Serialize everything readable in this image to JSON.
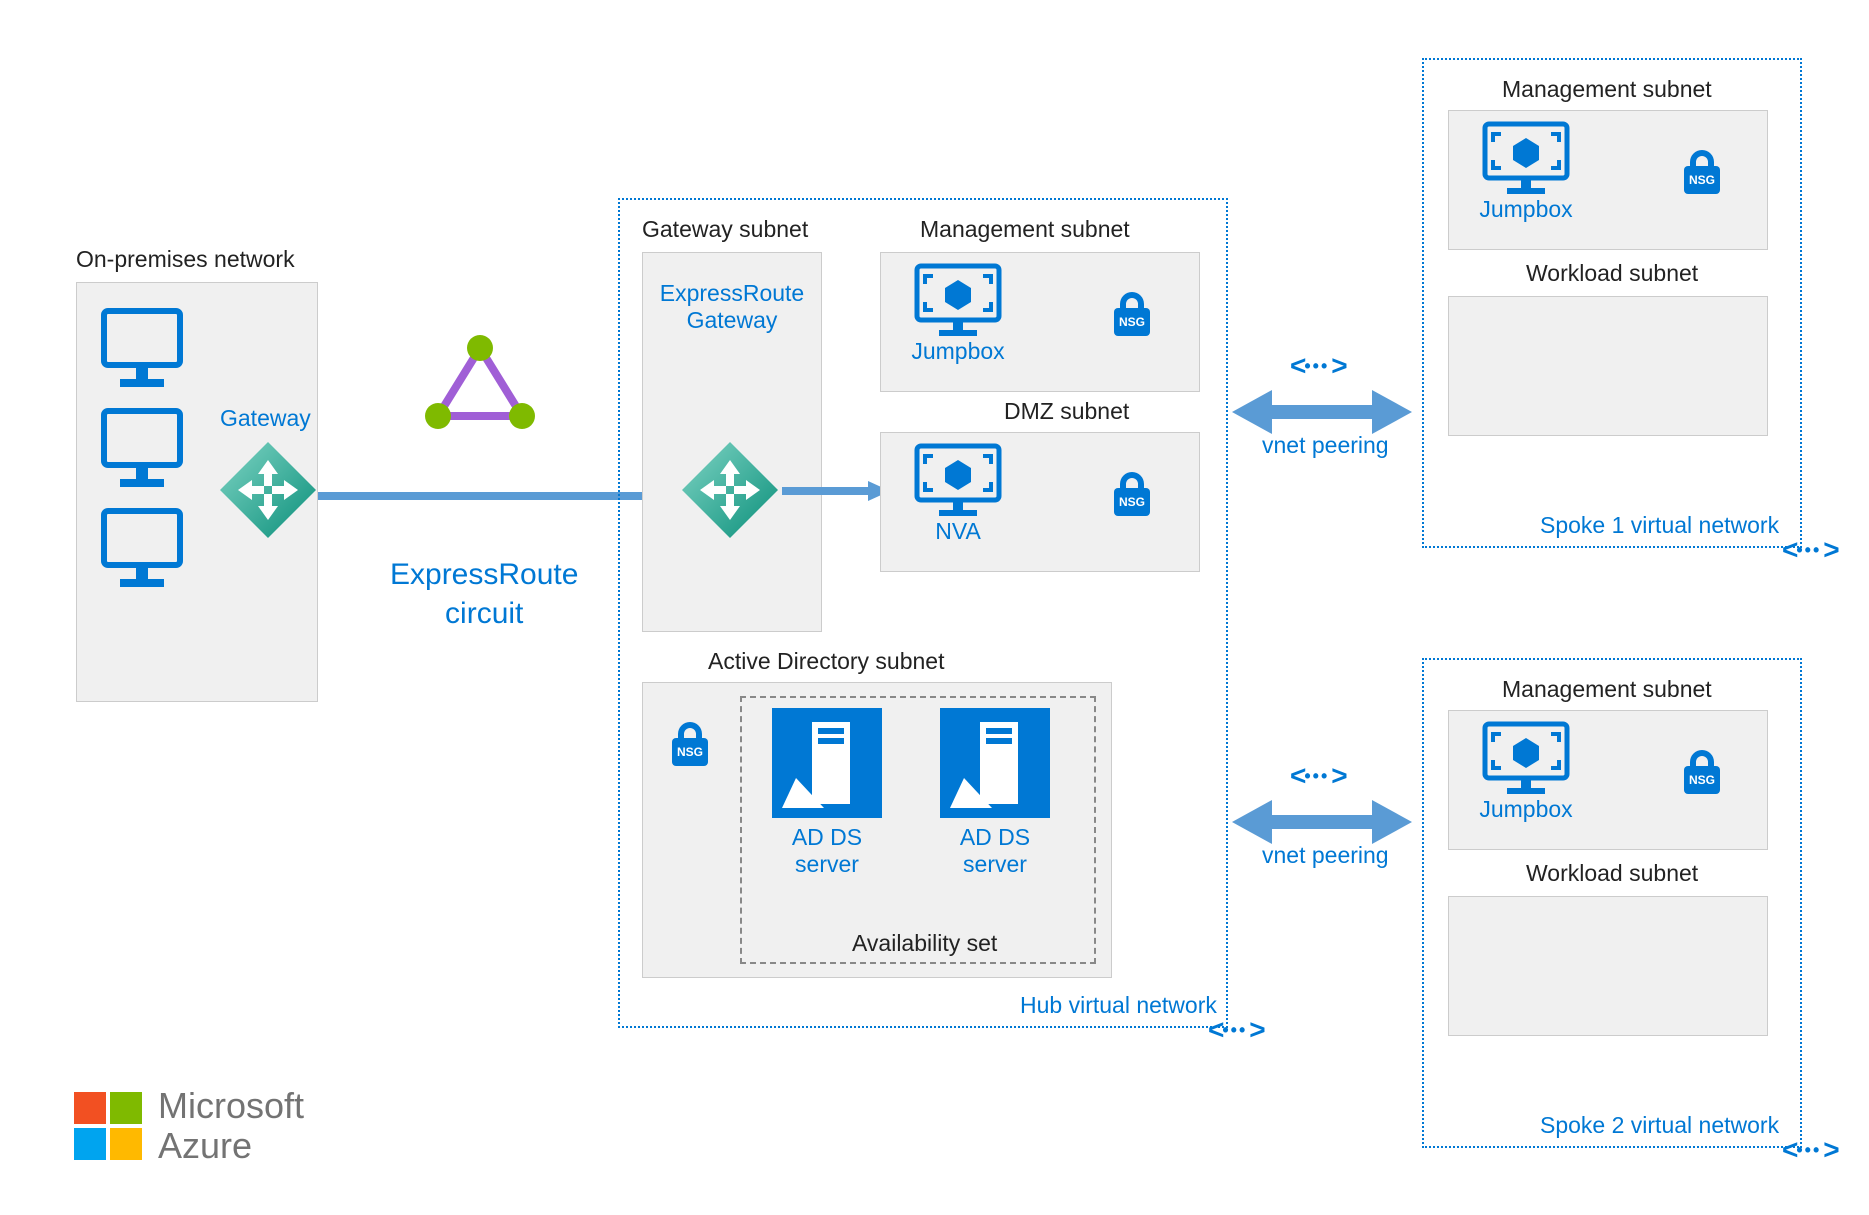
{
  "onprem": {
    "title": "On-premises network",
    "gateway": "Gateway"
  },
  "circuit": {
    "label": "ExpressRoute\ncircuit"
  },
  "hub": {
    "title": "Hub virtual network",
    "gateway_subnet": {
      "title": "Gateway subnet",
      "gateway": "ExpressRoute\nGateway"
    },
    "mgmt": {
      "title": "Management subnet",
      "jumpbox": "Jumpbox",
      "nsg": "NSG"
    },
    "dmz": {
      "title": "DMZ subnet",
      "nva": "NVA",
      "nsg": "NSG"
    },
    "ad": {
      "title": "Active Directory subnet",
      "avail": "Availability set",
      "server1": "AD DS\nserver",
      "server2": "AD DS\nserver",
      "nsg": "NSG"
    }
  },
  "peering": {
    "label": "vnet peering"
  },
  "spoke1": {
    "title": "Spoke 1 virtual network",
    "mgmt": {
      "title": "Management subnet",
      "jumpbox": "Jumpbox",
      "nsg": "NSG"
    },
    "workload": {
      "title": "Workload subnet"
    }
  },
  "spoke2": {
    "title": "Spoke 2 virtual network",
    "mgmt": {
      "title": "Management subnet",
      "jumpbox": "Jumpbox",
      "nsg": "NSG"
    },
    "workload": {
      "title": "Workload subnet"
    }
  },
  "brand": {
    "line1": "Microsoft",
    "line2": "Azure"
  }
}
